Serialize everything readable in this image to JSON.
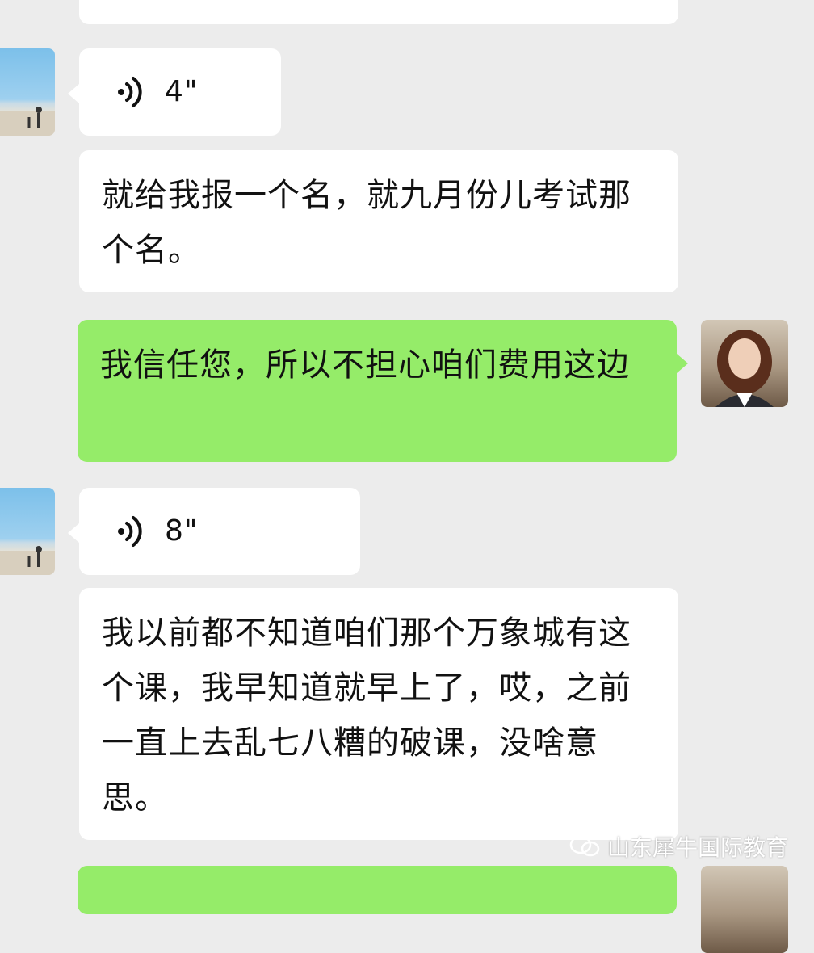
{
  "conversation": {
    "messages": [
      {
        "sender": "other",
        "type": "text",
        "text": ""
      },
      {
        "sender": "other",
        "type": "voice",
        "duration": "4\""
      },
      {
        "sender": "other",
        "type": "text",
        "text": "就给我报一个名，就九月份儿考试那个名。"
      },
      {
        "sender": "self",
        "type": "text",
        "text": "我信任您，所以不担心咱们费用这边"
      },
      {
        "sender": "other",
        "type": "voice",
        "duration": "8\""
      },
      {
        "sender": "other",
        "type": "text",
        "text": "我以前都不知道咱们那个万象城有这个课，我早知道就早上了，哎，之前一直上去乱七八糟的破课，没啥意思。"
      },
      {
        "sender": "self",
        "type": "text",
        "text": ""
      }
    ]
  },
  "watermark": {
    "text": "山东犀牛国际教育",
    "icon": "wechat-official-account-icon"
  },
  "colors": {
    "background": "#ececec",
    "incoming_bubble": "#ffffff",
    "outgoing_bubble": "#95ec69",
    "text": "#111111"
  }
}
